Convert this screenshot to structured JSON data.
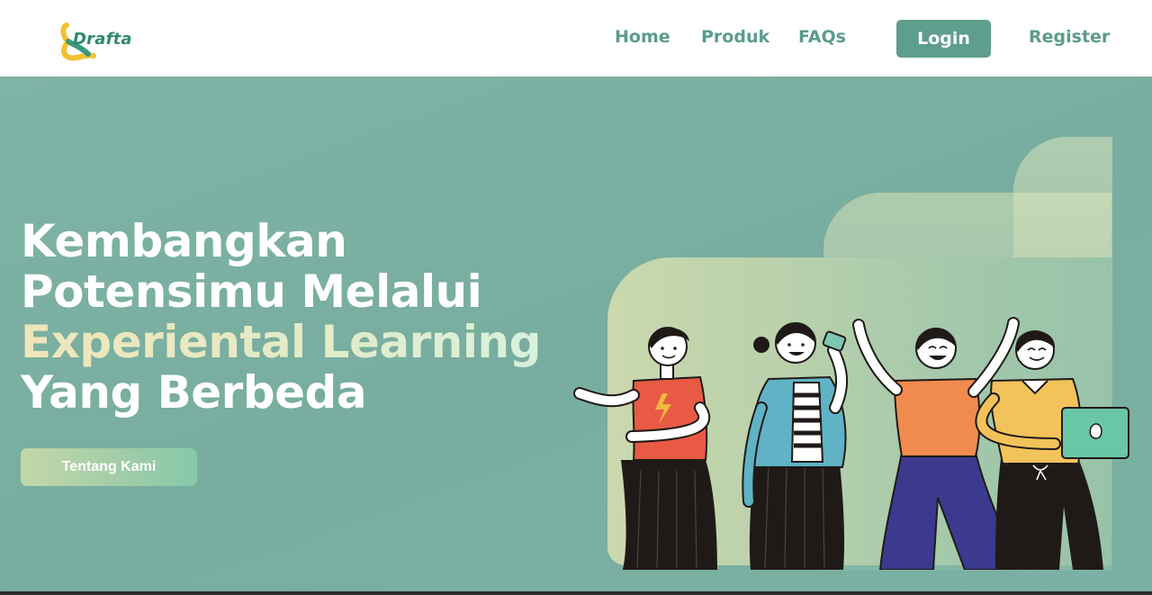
{
  "brand": {
    "name": "Drafta",
    "logo_icon": "drafta-logo-icon"
  },
  "nav": {
    "items": [
      {
        "label": "Home"
      },
      {
        "label": "Produk"
      },
      {
        "label": "FAQs"
      }
    ],
    "login_label": "Login",
    "register_label": "Register"
  },
  "hero": {
    "headline_line1": "Kembangkan",
    "headline_line2": "Potensimu Melalui",
    "headline_accent": "Experiental Learning",
    "headline_line4": "Yang Berbeda",
    "cta_label": "Tentang Kami",
    "illustration": "group-of-four-people-illustration"
  },
  "colors": {
    "brand_green": "#5e9e8d",
    "hero_bg": "#7aafa2",
    "accent_gradient_start": "#efe6b9",
    "accent_gradient_end": "#d8f1dc"
  }
}
